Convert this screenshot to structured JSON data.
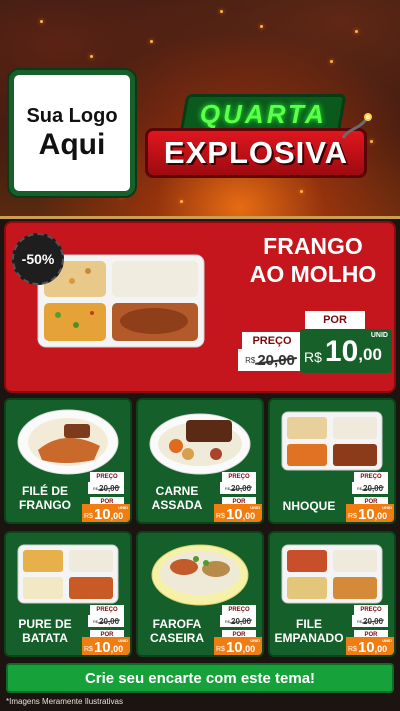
{
  "header": {
    "logo_line1": "Sua Logo",
    "logo_line2": "Aqui",
    "title_top": "QUARTA",
    "title_bottom": "EXPLOSIVA"
  },
  "featured": {
    "discount": "-50%",
    "name_line1": "FRANGO",
    "name_line2": "AO MOLHO",
    "preco_label": "PREÇO",
    "old_currency": "R$",
    "old_price": "20,00",
    "por_label": "POR",
    "new_currency": "R$",
    "new_price_int": "10",
    "new_price_dec": ",00",
    "unit": "UNID"
  },
  "products": [
    {
      "name_line1": "FILÉ DE",
      "name_line2": "FRANGO",
      "preco_label": "PREÇO",
      "old_currency": "R$",
      "old_price": "20,00",
      "por_label": "POR",
      "currency": "R$",
      "price_int": "10",
      "price_dec": ",00",
      "unit": "UNID"
    },
    {
      "name_line1": "CARNE",
      "name_line2": "ASSADA",
      "preco_label": "PREÇO",
      "old_currency": "R$",
      "old_price": "20,00",
      "por_label": "POR",
      "currency": "R$",
      "price_int": "10",
      "price_dec": ",00",
      "unit": "UNID"
    },
    {
      "name_line1": "",
      "name_line2": "NHOQUE",
      "preco_label": "PREÇO",
      "old_currency": "R$",
      "old_price": "20,00",
      "por_label": "POR",
      "currency": "R$",
      "price_int": "10",
      "price_dec": ",00",
      "unit": "UNID"
    },
    {
      "name_line1": "PURE DE",
      "name_line2": "BATATA",
      "preco_label": "PREÇO",
      "old_currency": "R$",
      "old_price": "20,00",
      "por_label": "POR",
      "currency": "R$",
      "price_int": "10",
      "price_dec": ",00",
      "unit": "UNID"
    },
    {
      "name_line1": "FAROFA",
      "name_line2": "CASEIRA",
      "preco_label": "PREÇO",
      "old_currency": "R$",
      "old_price": "20,00",
      "por_label": "POR",
      "currency": "R$",
      "price_int": "10",
      "price_dec": ",00",
      "unit": "UNID"
    },
    {
      "name_line1": "FILE",
      "name_line2": "EMPANADO",
      "preco_label": "PREÇO",
      "old_currency": "R$",
      "old_price": "20,00",
      "por_label": "POR",
      "currency": "R$",
      "price_int": "10",
      "price_dec": ",00",
      "unit": "UNID"
    }
  ],
  "footer": {
    "cta": "Crie seu encarte com este tema!",
    "disclaimer": "*Imagens Meramente Ilustrativas"
  },
  "colors": {
    "brand_green": "#17602a",
    "brand_red": "#c4161c",
    "price_orange": "#f07d12",
    "cta_green": "#17a13a"
  }
}
